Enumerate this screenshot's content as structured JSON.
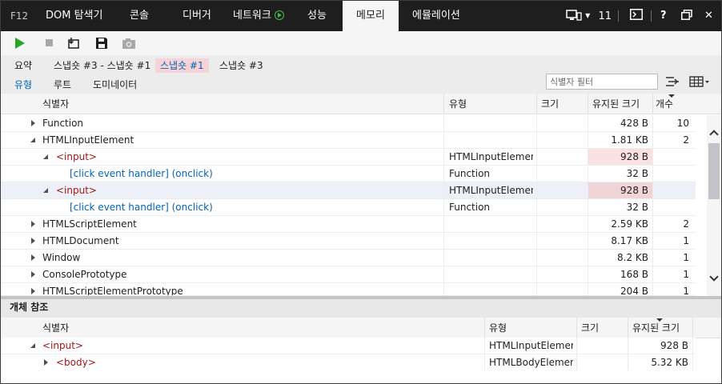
{
  "tabs": [
    {
      "label": "F12"
    },
    {
      "label": "DOM 탐색기"
    },
    {
      "label": "콘솔"
    },
    {
      "label": "디버거"
    },
    {
      "label": "네트워크"
    },
    {
      "label": "성능"
    },
    {
      "label": "메모리"
    },
    {
      "label": "에뮬레이션"
    }
  ],
  "topbar": {
    "device_count": "11",
    "console_icon": "console-icon",
    "help_label": "?",
    "restore_icon": "restore-window-icon",
    "close_label": "✕",
    "accent": "#3dc43d"
  },
  "toolbar": {
    "icons": [
      "play-icon",
      "stop-icon",
      "import-icon",
      "save-icon",
      "camera-icon"
    ]
  },
  "subtabs": {
    "items": [
      {
        "label": "요약"
      },
      {
        "label": "스냅숏 #3 - 스냅숏 #1"
      },
      {
        "label": "스냅숏 #1"
      },
      {
        "label": "스냅숏 #3"
      }
    ],
    "views": [
      {
        "label": "유형"
      },
      {
        "label": "루트"
      },
      {
        "label": "도미네이터"
      }
    ],
    "filter_placeholder": "식별자 필터",
    "selected_color": "#f6d3d6"
  },
  "main_table": {
    "columns": [
      "식별자",
      "유형",
      "크기",
      "유지된 크기",
      "개수"
    ],
    "rows": [
      {
        "id": "Function",
        "type": "",
        "size": "",
        "retained": "428 B",
        "count": "10"
      },
      {
        "id": "HTMLInputElement",
        "type": "",
        "size": "",
        "retained": "1.81 KB",
        "count": "2"
      },
      {
        "id": "<input>",
        "type": "HTMLInputElement",
        "size": "",
        "retained": "928 B",
        "count": ""
      },
      {
        "id": "[click event handler] (onclick)",
        "type": "Function",
        "size": "",
        "retained": "32 B",
        "count": ""
      },
      {
        "id": "<input>",
        "type": "HTMLInputElement",
        "size": "",
        "retained": "928 B",
        "count": ""
      },
      {
        "id": "[click event handler] (onclick)",
        "type": "Function",
        "size": "",
        "retained": "32 B",
        "count": ""
      },
      {
        "id": "HTMLScriptElement",
        "type": "",
        "size": "",
        "retained": "2.59 KB",
        "count": "2"
      },
      {
        "id": "HTMLDocument",
        "type": "",
        "size": "",
        "retained": "8.17 KB",
        "count": "1"
      },
      {
        "id": "Window",
        "type": "",
        "size": "",
        "retained": "8.2 KB",
        "count": "1"
      },
      {
        "id": "ConsolePrototype",
        "type": "",
        "size": "",
        "retained": "168 B",
        "count": "1"
      },
      {
        "id": "HTMLScriptElementPrototype",
        "type": "",
        "size": "",
        "retained": "204 B",
        "count": "1"
      }
    ]
  },
  "references": {
    "title": "개체 참조",
    "columns": [
      "식별자",
      "유형",
      "크기",
      "유지된 크기"
    ],
    "rows": [
      {
        "id": "<input>",
        "type": "HTMLInputElement",
        "size": "",
        "retained": "928 B"
      },
      {
        "id": "<body>",
        "type": "HTMLBodyElement",
        "size": "",
        "retained": "5.32 KB"
      }
    ]
  }
}
